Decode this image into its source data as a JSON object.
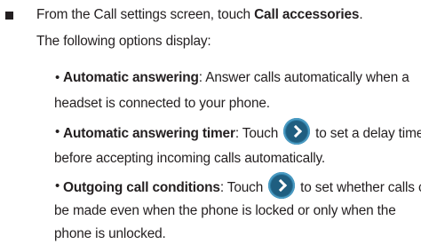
{
  "step": {
    "intro_prefix": "From the Call settings screen, touch ",
    "intro_bold": "Call accessories",
    "intro_suffix": ".",
    "sub_intro": "The following options display:"
  },
  "options": [
    {
      "title": "Automatic answering",
      "line1_rest": ": Answer calls automatically when a",
      "line2": "headset is connected to your phone."
    },
    {
      "title": "Automatic answering timer",
      "line1_mid": ": Touch",
      "icon": "chevron-right-circle-icon",
      "line1_rest": "to set a delay time",
      "line2": "before accepting incoming calls automatically."
    },
    {
      "title": "Outgoing call conditions",
      "line1_mid": ": Touch",
      "icon": "chevron-right-circle-icon",
      "line1_rest": "to set whether calls can",
      "line2": "be made even when the phone is locked or only when the",
      "line3": "phone is unlocked."
    }
  ],
  "colors": {
    "text": "#231f20",
    "icon_bg": "#2e7fa8"
  }
}
